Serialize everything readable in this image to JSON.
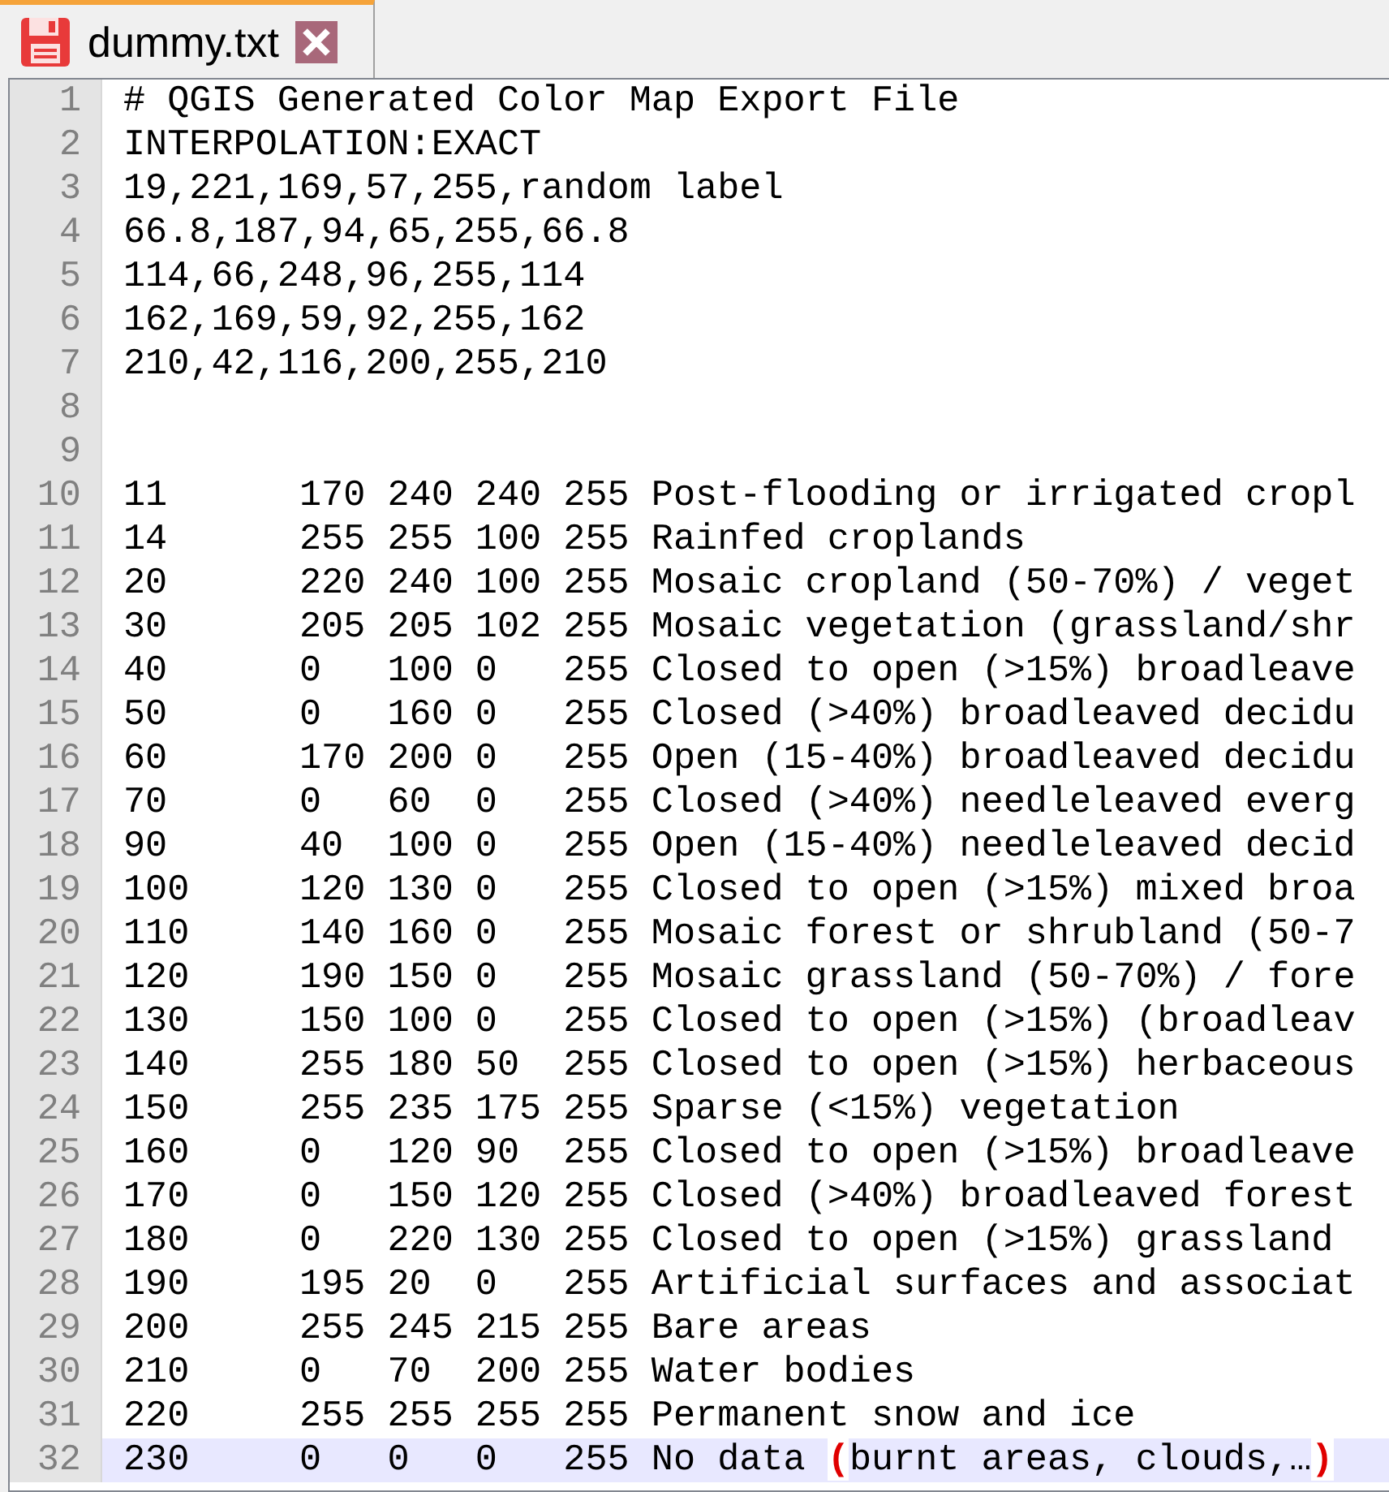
{
  "tab": {
    "title": "dummy.txt",
    "selected": true,
    "modified": true
  },
  "lines": [
    {
      "number": "1",
      "text": "# QGIS Generated Color Map Export File",
      "selected": false
    },
    {
      "number": "2",
      "text": "INTERPOLATION:EXACT",
      "selected": false
    },
    {
      "number": "3",
      "text": "19,221,169,57,255,random label",
      "selected": false
    },
    {
      "number": "4",
      "text": "66.8,187,94,65,255,66.8",
      "selected": false
    },
    {
      "number": "5",
      "text": "114,66,248,96,255,114",
      "selected": false
    },
    {
      "number": "6",
      "text": "162,169,59,92,255,162",
      "selected": false
    },
    {
      "number": "7",
      "text": "210,42,116,200,255,210",
      "selected": false
    },
    {
      "number": "8",
      "selected": false
    },
    {
      "number": "9",
      "selected": false
    },
    {
      "number": "10",
      "text": "11      170 240 240 255 Post-flooding or irrigated cropl",
      "selected": false
    },
    {
      "number": "11",
      "text": "14      255 255 100 255 Rainfed croplands",
      "selected": false
    },
    {
      "number": "12",
      "text": "20      220 240 100 255 Mosaic cropland (50-70%) / veget",
      "selected": false
    },
    {
      "number": "13",
      "text": "30      205 205 102 255 Mosaic vegetation (grassland/shr",
      "selected": false
    },
    {
      "number": "14",
      "text": "40      0   100 0   255 Closed to open (>15%) broadleave",
      "selected": false
    },
    {
      "number": "15",
      "text": "50      0   160 0   255 Closed (>40%) broadleaved decidu",
      "selected": false
    },
    {
      "number": "16",
      "text": "60      170 200 0   255 Open (15-40%) broadleaved decidu",
      "selected": false
    },
    {
      "number": "17",
      "text": "70      0   60  0   255 Closed (>40%) needleleaved everg",
      "selected": false
    },
    {
      "number": "18",
      "text": "90      40  100 0   255 Open (15-40%) needleleaved decid",
      "selected": false
    },
    {
      "number": "19",
      "text": "100     120 130 0   255 Closed to open (>15%) mixed broa",
      "selected": false
    },
    {
      "number": "20",
      "text": "110     140 160 0   255 Mosaic forest or shrubland (50-7",
      "selected": false
    },
    {
      "number": "21",
      "text": "120     190 150 0   255 Mosaic grassland (50-70%) / fore",
      "selected": false
    },
    {
      "number": "22",
      "text": "130     150 100 0   255 Closed to open (>15%) (broadleav",
      "selected": false
    },
    {
      "number": "23",
      "text": "140     255 180 50  255 Closed to open (>15%) herbaceous",
      "selected": false
    },
    {
      "number": "24",
      "text": "150     255 235 175 255 Sparse (<15%) vegetation",
      "selected": false
    },
    {
      "number": "25",
      "text": "160     0   120 90  255 Closed to open (>15%) broadleave",
      "selected": false
    },
    {
      "number": "26",
      "text": "170     0   150 120 255 Closed (>40%) broadleaved forest",
      "selected": false
    },
    {
      "number": "27",
      "text": "180     0   220 130 255 Closed to open (>15%) grassland",
      "selected": false
    },
    {
      "number": "28",
      "text": "190     195 20  0   255 Artificial surfaces and associat",
      "selected": false
    },
    {
      "number": "29",
      "text": "200     255 245 215 255 Bare areas",
      "selected": false
    },
    {
      "number": "30",
      "text": "210     0   70  200 255 Water bodies",
      "selected": false
    },
    {
      "number": "31",
      "text": "220     255 255 255 255 Permanent snow and ice",
      "selected": false
    },
    {
      "number": "32",
      "text": "230     0   0   0   255 No data **(**burnt areas, clouds,…**)**",
      "selected": true
    }
  ]
}
